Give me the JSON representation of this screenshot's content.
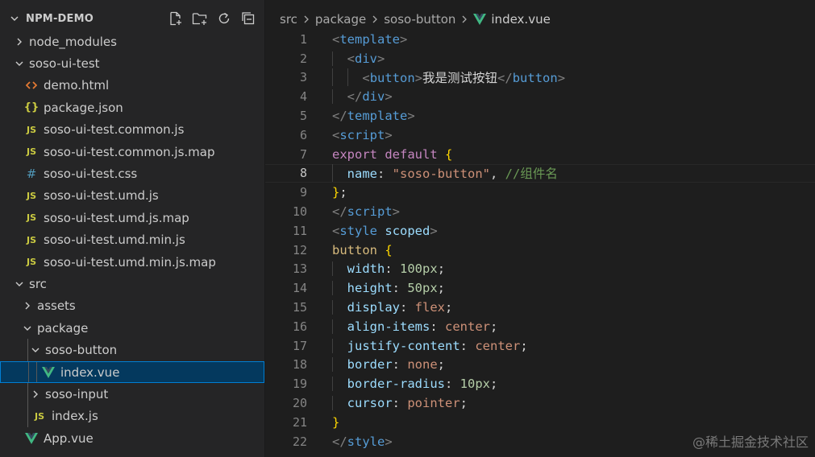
{
  "explorer": {
    "title": "NPM-DEMO",
    "actions": [
      "new-file-icon",
      "new-folder-icon",
      "refresh-icon",
      "collapse-all-icon"
    ],
    "items": [
      {
        "label": "node_modules",
        "type": "folder",
        "expanded": false,
        "depth": 1
      },
      {
        "label": "soso-ui-test",
        "type": "folder",
        "expanded": true,
        "depth": 1
      },
      {
        "label": "demo.html",
        "type": "html",
        "depth": 2
      },
      {
        "label": "package.json",
        "type": "json",
        "depth": 2
      },
      {
        "label": "soso-ui-test.common.js",
        "type": "js",
        "depth": 2
      },
      {
        "label": "soso-ui-test.common.js.map",
        "type": "js",
        "depth": 2
      },
      {
        "label": "soso-ui-test.css",
        "type": "css",
        "depth": 2
      },
      {
        "label": "soso-ui-test.umd.js",
        "type": "js",
        "depth": 2
      },
      {
        "label": "soso-ui-test.umd.js.map",
        "type": "js",
        "depth": 2
      },
      {
        "label": "soso-ui-test.umd.min.js",
        "type": "js",
        "depth": 2
      },
      {
        "label": "soso-ui-test.umd.min.js.map",
        "type": "js",
        "depth": 2
      },
      {
        "label": "src",
        "type": "folder",
        "expanded": true,
        "depth": 1
      },
      {
        "label": "assets",
        "type": "folder",
        "expanded": false,
        "depth": 2
      },
      {
        "label": "package",
        "type": "folder",
        "expanded": true,
        "depth": 2
      },
      {
        "label": "soso-button",
        "type": "folder",
        "expanded": true,
        "depth": 3
      },
      {
        "label": "index.vue",
        "type": "vue",
        "depth": 4,
        "selected": true
      },
      {
        "label": "soso-input",
        "type": "folder",
        "expanded": false,
        "depth": 3
      },
      {
        "label": "index.js",
        "type": "js",
        "depth": 3
      },
      {
        "label": "App.vue",
        "type": "vue",
        "depth": 2
      }
    ]
  },
  "breadcrumb": [
    "src",
    "package",
    "soso-button",
    "index.vue"
  ],
  "editor": {
    "current_line": 8,
    "lines": [
      {
        "n": "1",
        "indent": 0,
        "tokens": [
          [
            "br",
            "<"
          ],
          [
            "tag",
            "template"
          ],
          [
            "br",
            ">"
          ]
        ]
      },
      {
        "n": "2",
        "indent": 1,
        "tokens": [
          [
            "br",
            "<"
          ],
          [
            "tag",
            "div"
          ],
          [
            "br",
            ">"
          ]
        ]
      },
      {
        "n": "3",
        "indent": 2,
        "tokens": [
          [
            "br",
            "<"
          ],
          [
            "tag",
            "button"
          ],
          [
            "br",
            ">"
          ],
          [
            "text",
            "我是测试按钮"
          ],
          [
            "br",
            "</"
          ],
          [
            "tag",
            "button"
          ],
          [
            "br",
            ">"
          ]
        ]
      },
      {
        "n": "4",
        "indent": 1,
        "tokens": [
          [
            "br",
            "</"
          ],
          [
            "tag",
            "div"
          ],
          [
            "br",
            ">"
          ]
        ]
      },
      {
        "n": "5",
        "indent": 0,
        "tokens": [
          [
            "br",
            "</"
          ],
          [
            "tag",
            "template"
          ],
          [
            "br",
            ">"
          ]
        ]
      },
      {
        "n": "6",
        "indent": 0,
        "tokens": [
          [
            "br",
            "<"
          ],
          [
            "tag",
            "script"
          ],
          [
            "br",
            ">"
          ]
        ]
      },
      {
        "n": "7",
        "indent": 0,
        "tokens": [
          [
            "kw",
            "export"
          ],
          [
            "text",
            " "
          ],
          [
            "kw",
            "default"
          ],
          [
            "text",
            " "
          ],
          [
            "curly",
            "{"
          ]
        ]
      },
      {
        "n": "8",
        "indent": 1,
        "tokens": [
          [
            "prop",
            "name"
          ],
          [
            "punc",
            ": "
          ],
          [
            "str",
            "\"soso-button\""
          ],
          [
            "punc",
            ", "
          ],
          [
            "comment",
            "//组件名"
          ]
        ]
      },
      {
        "n": "9",
        "indent": 0,
        "tokens": [
          [
            "curly",
            "}"
          ],
          [
            "punc",
            ";"
          ]
        ]
      },
      {
        "n": "10",
        "indent": 0,
        "tokens": [
          [
            "br",
            "</"
          ],
          [
            "tag",
            "script"
          ],
          [
            "br",
            ">"
          ]
        ]
      },
      {
        "n": "11",
        "indent": 0,
        "tokens": [
          [
            "br",
            "<"
          ],
          [
            "tag",
            "style"
          ],
          [
            "text",
            " "
          ],
          [
            "attr",
            "scoped"
          ],
          [
            "br",
            ">"
          ]
        ]
      },
      {
        "n": "12",
        "indent": 0,
        "tokens": [
          [
            "sel",
            "button"
          ],
          [
            "text",
            " "
          ],
          [
            "curly",
            "{"
          ]
        ]
      },
      {
        "n": "13",
        "indent": 1,
        "tokens": [
          [
            "prop",
            "width"
          ],
          [
            "punc",
            ": "
          ],
          [
            "num",
            "100px"
          ],
          [
            "punc",
            ";"
          ]
        ]
      },
      {
        "n": "14",
        "indent": 1,
        "tokens": [
          [
            "prop",
            "height"
          ],
          [
            "punc",
            ": "
          ],
          [
            "num",
            "50px"
          ],
          [
            "punc",
            ";"
          ]
        ]
      },
      {
        "n": "15",
        "indent": 1,
        "tokens": [
          [
            "prop",
            "display"
          ],
          [
            "punc",
            ": "
          ],
          [
            "val",
            "flex"
          ],
          [
            "punc",
            ";"
          ]
        ]
      },
      {
        "n": "16",
        "indent": 1,
        "tokens": [
          [
            "prop",
            "align-items"
          ],
          [
            "punc",
            ": "
          ],
          [
            "val",
            "center"
          ],
          [
            "punc",
            ";"
          ]
        ]
      },
      {
        "n": "17",
        "indent": 1,
        "tokens": [
          [
            "prop",
            "justify-content"
          ],
          [
            "punc",
            ": "
          ],
          [
            "val",
            "center"
          ],
          [
            "punc",
            ";"
          ]
        ]
      },
      {
        "n": "18",
        "indent": 1,
        "tokens": [
          [
            "prop",
            "border"
          ],
          [
            "punc",
            ": "
          ],
          [
            "val",
            "none"
          ],
          [
            "punc",
            ";"
          ]
        ]
      },
      {
        "n": "19",
        "indent": 1,
        "tokens": [
          [
            "prop",
            "border-radius"
          ],
          [
            "punc",
            ": "
          ],
          [
            "num",
            "10px"
          ],
          [
            "punc",
            ";"
          ]
        ]
      },
      {
        "n": "20",
        "indent": 1,
        "tokens": [
          [
            "prop",
            "cursor"
          ],
          [
            "punc",
            ": "
          ],
          [
            "val",
            "pointer"
          ],
          [
            "punc",
            ";"
          ]
        ]
      },
      {
        "n": "21",
        "indent": 0,
        "tokens": [
          [
            "curly",
            "}"
          ]
        ]
      },
      {
        "n": "22",
        "indent": 0,
        "tokens": [
          [
            "br",
            "</"
          ],
          [
            "tag",
            "style"
          ],
          [
            "br",
            ">"
          ]
        ]
      }
    ]
  },
  "watermark": "@稀土掘金技术社区",
  "colors": {
    "sidebar_bg": "#252526",
    "editor_bg": "#1e1e1e",
    "selection_bg": "#04395e",
    "selection_border": "#007fd4",
    "vue_green": "#41b883"
  }
}
